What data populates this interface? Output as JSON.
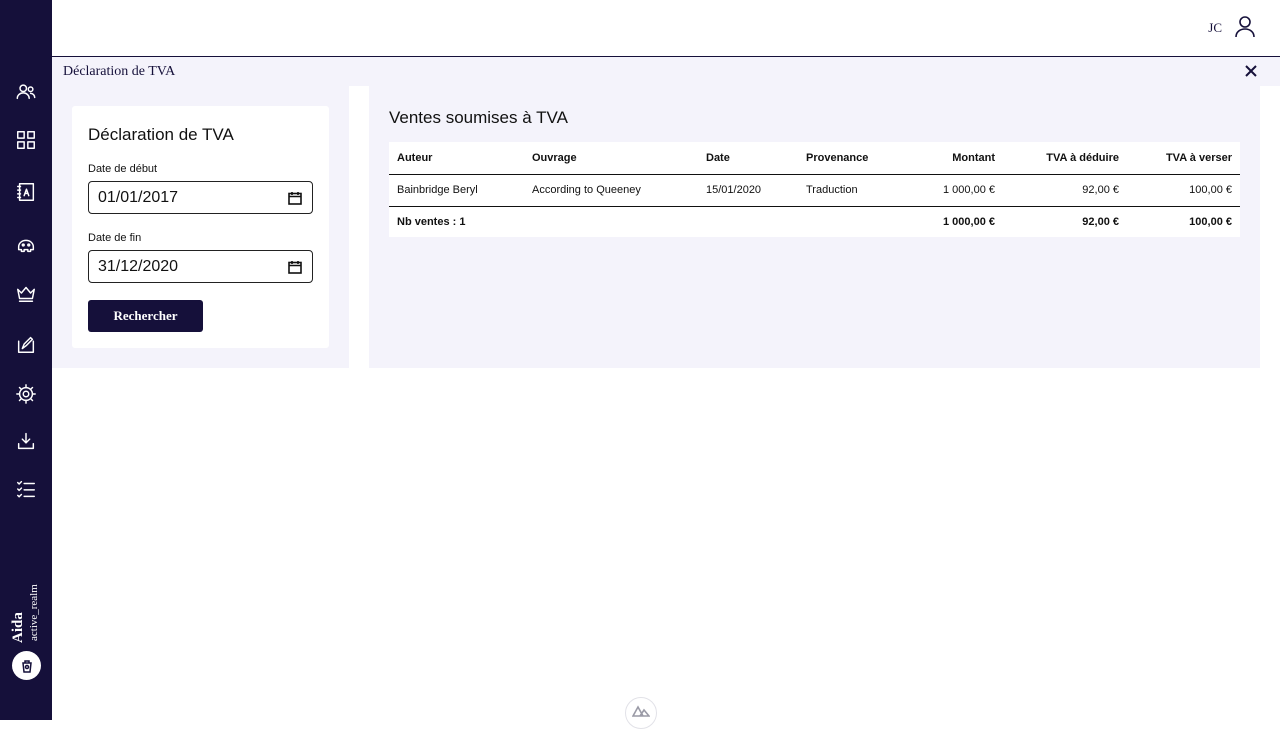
{
  "app": {
    "name": "Aida",
    "realm": "active_realm"
  },
  "topbar": {
    "user_initials": "JC"
  },
  "sidebar": {
    "items": [
      {
        "icon": "users-icon"
      },
      {
        "icon": "dashboard-grid-icon"
      },
      {
        "icon": "translation-book-icon"
      },
      {
        "icon": "piggy-bank-icon"
      },
      {
        "icon": "crown-icon"
      },
      {
        "icon": "edit-document-icon"
      },
      {
        "icon": "gear-icon"
      },
      {
        "icon": "download-icon"
      },
      {
        "icon": "checklist-icon"
      }
    ]
  },
  "panel": {
    "title": "Déclaration de TVA"
  },
  "search": {
    "title": "Déclaration de TVA",
    "start_label": "Date de début",
    "start_value": "01/01/2017",
    "end_label": "Date de fin",
    "end_value": "31/12/2020",
    "button_label": "Rechercher"
  },
  "results": {
    "title": "Ventes soumises à TVA",
    "columns": [
      "Auteur",
      "Ouvrage",
      "Date",
      "Provenance",
      "Montant",
      "TVA à déduire",
      "TVA à verser"
    ],
    "rows": [
      [
        "Bainbridge Beryl",
        "According to Queeney",
        "15/01/2020",
        "Traduction",
        "1 000,00 €",
        "92,00 €",
        "100,00 €"
      ]
    ],
    "total": {
      "label": "Nb ventes : 1",
      "montant": "1 000,00 €",
      "tva_deduire": "92,00 €",
      "tva_verser": "100,00 €"
    }
  },
  "colors": {
    "brand": "#15103a",
    "panel_bg": "#f4f3fb"
  }
}
